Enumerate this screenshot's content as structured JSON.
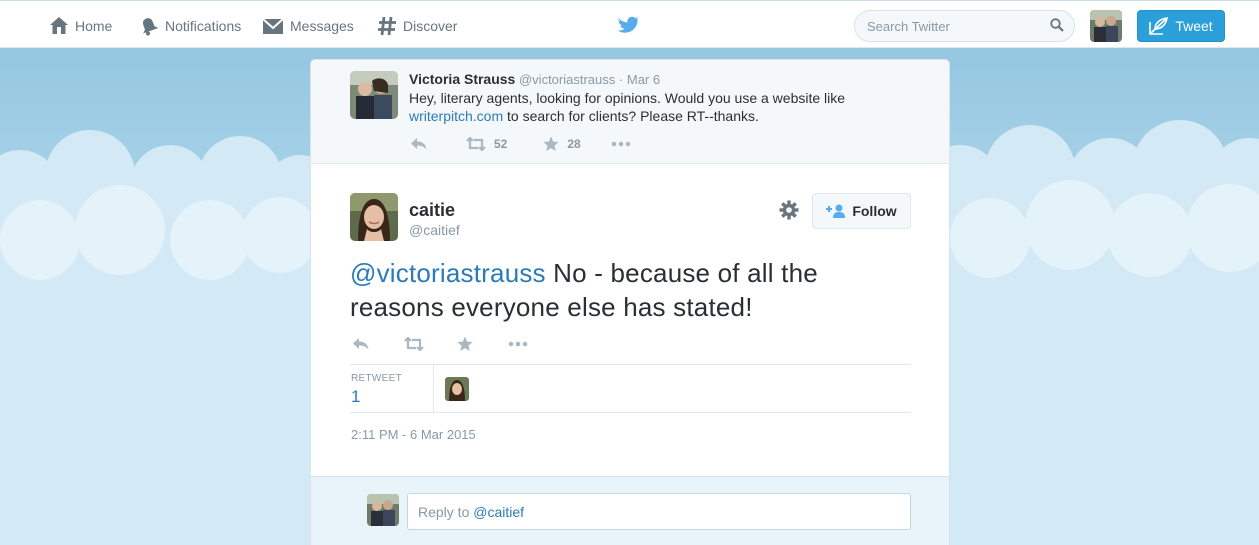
{
  "nav": {
    "home": "Home",
    "notifications": "Notifications",
    "messages": "Messages",
    "discover": "Discover",
    "search_placeholder": "Search Twitter",
    "tweet_button": "Tweet"
  },
  "ancestor_tweet": {
    "fullname": "Victoria Strauss",
    "screen_name": "@victoriastrauss",
    "separator": "·",
    "date": "Mar 6",
    "text_before": "Hey, literary agents, looking for opinions. Would you use a website like",
    "link": "writerpitch.com",
    "text_after": " to search for clients? Please RT--thanks.",
    "retweets": "52",
    "favorites": "28"
  },
  "main_tweet": {
    "fullname": "caitie",
    "screen_name": "@caitief",
    "follow_label": "Follow",
    "mention": "@victoriastrauss",
    "text": " No - because of all the reasons everyone else has stated!",
    "retweet_label": "RETWEET",
    "retweet_count": "1",
    "timestamp": "2:11 PM - 6 Mar 2015"
  },
  "reply": {
    "prefix": "Reply to ",
    "handle": "@caitief"
  },
  "colors": {
    "accent": "#2b7bb9",
    "tweet_button": "#2b9fd9",
    "sky": "#a9d3e9"
  }
}
